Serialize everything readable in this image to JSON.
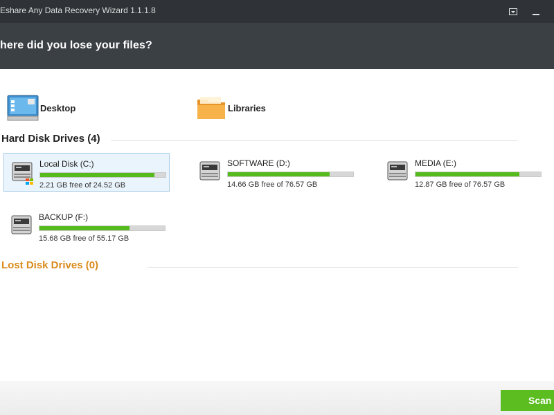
{
  "window": {
    "title": "Eshare Any Data Recovery Wizard 1.1.1.8"
  },
  "header": {
    "question": "here did you lose your files?"
  },
  "locations": [
    {
      "label": "Desktop",
      "icon": "desktop-icon"
    },
    {
      "label": "Libraries",
      "icon": "folder-icon"
    }
  ],
  "hard_disk_section": {
    "title": "Hard Disk Drives (4)"
  },
  "drives": [
    {
      "name": "Local Disk (C:)",
      "free_text": "2.21 GB free of 24.52 GB",
      "used_fraction": 0.91,
      "selected": true,
      "icon": "windows-drive-icon"
    },
    {
      "name": "SOFTWARE (D:)",
      "free_text": "14.66 GB free of 76.57 GB",
      "used_fraction": 0.81,
      "selected": false,
      "icon": "hard-drive-icon"
    },
    {
      "name": "MEDIA (E:)",
      "free_text": "12.87 GB free of 76.57 GB",
      "used_fraction": 0.83,
      "selected": false,
      "icon": "hard-drive-icon"
    },
    {
      "name": "BACKUP (F:)",
      "free_text": "15.68 GB free of 55.17 GB",
      "used_fraction": 0.72,
      "selected": false,
      "icon": "hard-drive-icon"
    }
  ],
  "lost_disk_section": {
    "title": "Lost Disk Drives (0)"
  },
  "footer": {
    "scan_label": "Scan"
  },
  "colors": {
    "accent_green": "#5bbd1f",
    "lost_orange": "#d98a1a",
    "titlebar": "#2f3337",
    "header": "#3b4045"
  }
}
